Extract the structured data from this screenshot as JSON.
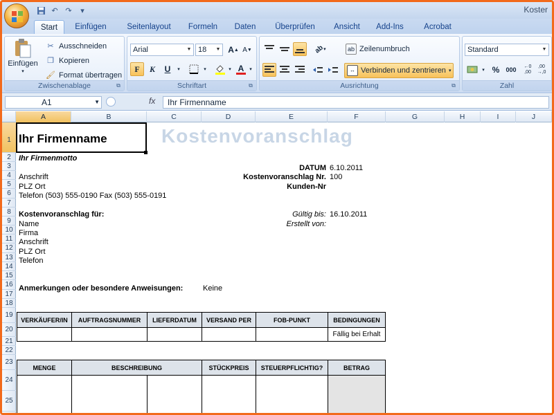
{
  "window": {
    "title": "Koster"
  },
  "tabs": [
    "Start",
    "Einfügen",
    "Seitenlayout",
    "Formeln",
    "Daten",
    "Überprüfen",
    "Ansicht",
    "Add-Ins",
    "Acrobat"
  ],
  "ribbon": {
    "clipboard": {
      "label": "Zwischenablage",
      "paste": "Einfügen",
      "cut": "Ausschneiden",
      "copy": "Kopieren",
      "format_painter": "Format übertragen"
    },
    "font": {
      "label": "Schriftart",
      "font_name": "Arial",
      "font_size": "18",
      "bold": "F",
      "italic": "K",
      "underline": "U"
    },
    "alignment": {
      "label": "Ausrichtung",
      "wrap": "Zeilenumbruch",
      "merge": "Verbinden und zentrieren"
    },
    "number": {
      "label": "Zahl",
      "format": "Standard",
      "percent": "%",
      "thousands": "000"
    }
  },
  "formula_bar": {
    "cell_ref": "A1",
    "fx": "fx",
    "content": "Ihr Firmenname"
  },
  "columns": [
    "A",
    "B",
    "C",
    "D",
    "E",
    "F",
    "G",
    "H",
    "I",
    "J"
  ],
  "rows": [
    "1",
    "2",
    "3",
    "4",
    "5",
    "6",
    "7",
    "8",
    "9",
    "10",
    "11",
    "12",
    "13",
    "14",
    "15",
    "16",
    "17",
    "18",
    "19",
    "20",
    "21",
    "22",
    "23",
    "24",
    "25"
  ],
  "sheet": {
    "company_name": "Ihr Firmenname",
    "doc_title": "Kostenvoranschlag",
    "motto": "Ihr Firmenmotto",
    "address": "Anschrift",
    "city": "PLZ Ort",
    "phone_fax": "Telefon (503) 555-0190  Fax (503) 555-0191",
    "date_label": "DATUM",
    "date_value": "6.10.2011",
    "quote_no_label": "Kostenvoranschlag Nr.",
    "quote_no_value": "100",
    "customer_no_label": "Kunden-Nr",
    "quote_for_label": "Kostenvoranschlag für:",
    "valid_label": "Gültig bis:",
    "valid_value": "16.10.2011",
    "created_label": "Erstellt von:",
    "client_name": "Name",
    "client_company": "Firma",
    "client_address": "Anschrift",
    "client_city": "PLZ Ort",
    "client_phone": "Telefon",
    "notes_label": "Anmerkungen oder besondere Anweisungen:",
    "notes_value": "Keine",
    "table1_headers": [
      "VERKÄUFER/IN",
      "AUFTRAGSNUMMER",
      "LIEFERDATUM",
      "VERSAND PER",
      "FOB-PUNKT",
      "BEDINGUNGEN"
    ],
    "table1_terms": "Fällig bei Erhalt",
    "table2_headers": [
      "MENGE",
      "BESCHREIBUNG",
      "STÜCKPREIS",
      "STEUERPFLICHTIG?",
      "BETRAG"
    ]
  }
}
